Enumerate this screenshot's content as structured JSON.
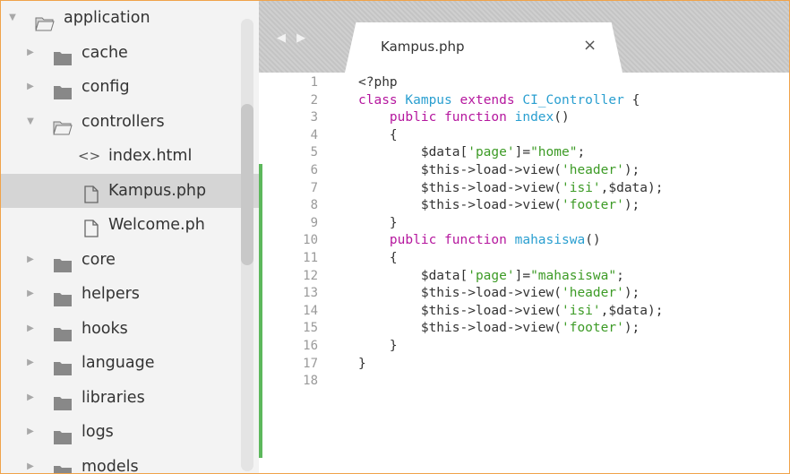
{
  "sidebar": {
    "items": [
      {
        "label": "application",
        "type": "folder-open",
        "depth": 0
      },
      {
        "label": "cache",
        "type": "folder",
        "depth": 1
      },
      {
        "label": "config",
        "type": "folder",
        "depth": 1
      },
      {
        "label": "controllers",
        "type": "folder-open",
        "depth": 1
      },
      {
        "label": "index.html",
        "type": "code-file",
        "depth": 2
      },
      {
        "label": "Kampus.php",
        "type": "file",
        "depth": 2,
        "selected": true
      },
      {
        "label": "Welcome.ph",
        "type": "file",
        "depth": 2
      },
      {
        "label": "core",
        "type": "folder",
        "depth": 1
      },
      {
        "label": "helpers",
        "type": "folder",
        "depth": 1
      },
      {
        "label": "hooks",
        "type": "folder",
        "depth": 1
      },
      {
        "label": "language",
        "type": "folder",
        "depth": 1
      },
      {
        "label": "libraries",
        "type": "folder",
        "depth": 1
      },
      {
        "label": "logs",
        "type": "folder",
        "depth": 1
      },
      {
        "label": "models",
        "type": "folder",
        "depth": 1
      }
    ]
  },
  "tabs": {
    "nav_arrows": "◀ ▶",
    "active": {
      "label": "Kampus.php",
      "close": "×"
    }
  },
  "code": {
    "lines": [
      {
        "n": "1",
        "tokens": [
          [
            "plain",
            "<?php"
          ]
        ]
      },
      {
        "n": "2",
        "tokens": [
          [
            "kw",
            "class "
          ],
          [
            "cls",
            "Kampus "
          ],
          [
            "kw",
            "extends "
          ],
          [
            "cls",
            "CI_Controller"
          ],
          [
            "plain",
            " {"
          ]
        ]
      },
      {
        "n": "3",
        "tokens": [
          [
            "plain",
            "    "
          ],
          [
            "kw",
            "public function "
          ],
          [
            "fn",
            "index"
          ],
          [
            "plain",
            "()"
          ]
        ]
      },
      {
        "n": "4",
        "tokens": [
          [
            "plain",
            "    {"
          ]
        ]
      },
      {
        "n": "5",
        "tokens": [
          [
            "plain",
            "        $data["
          ],
          [
            "str",
            "'page'"
          ],
          [
            "plain",
            "]="
          ],
          [
            "str",
            "\"home\""
          ],
          [
            "plain",
            ";"
          ]
        ]
      },
      {
        "n": "6",
        "tokens": [
          [
            "plain",
            "        $this->load->view("
          ],
          [
            "str",
            "'header'"
          ],
          [
            "plain",
            ");"
          ]
        ]
      },
      {
        "n": "7",
        "tokens": [
          [
            "plain",
            "        $this->load->view("
          ],
          [
            "str",
            "'isi'"
          ],
          [
            "plain",
            ",$data);"
          ]
        ]
      },
      {
        "n": "8",
        "tokens": [
          [
            "plain",
            "        $this->load->view("
          ],
          [
            "str",
            "'footer'"
          ],
          [
            "plain",
            ");"
          ]
        ]
      },
      {
        "n": "9",
        "tokens": [
          [
            "plain",
            "    }"
          ]
        ]
      },
      {
        "n": "10",
        "tokens": [
          [
            "plain",
            "    "
          ],
          [
            "kw",
            "public function "
          ],
          [
            "fn",
            "mahasiswa"
          ],
          [
            "plain",
            "()"
          ]
        ]
      },
      {
        "n": "11",
        "tokens": [
          [
            "plain",
            "    {"
          ]
        ]
      },
      {
        "n": "12",
        "tokens": [
          [
            "plain",
            "        $data["
          ],
          [
            "str",
            "'page'"
          ],
          [
            "plain",
            "]="
          ],
          [
            "str",
            "\"mahasiswa\""
          ],
          [
            "plain",
            ";"
          ]
        ]
      },
      {
        "n": "13",
        "tokens": [
          [
            "plain",
            "        $this->load->view("
          ],
          [
            "str",
            "'header'"
          ],
          [
            "plain",
            ");"
          ]
        ]
      },
      {
        "n": "14",
        "tokens": [
          [
            "plain",
            "        $this->load->view("
          ],
          [
            "str",
            "'isi'"
          ],
          [
            "plain",
            ",$data);"
          ]
        ]
      },
      {
        "n": "15",
        "tokens": [
          [
            "plain",
            "        $this->load->view("
          ],
          [
            "str",
            "'footer'"
          ],
          [
            "plain",
            ");"
          ]
        ]
      },
      {
        "n": "16",
        "tokens": [
          [
            "plain",
            "    }"
          ]
        ]
      },
      {
        "n": "17",
        "tokens": [
          [
            "plain",
            "}"
          ]
        ]
      },
      {
        "n": "18",
        "tokens": []
      }
    ]
  },
  "colors": {
    "keyword": "#b5179e",
    "class_name": "#2a9fd0",
    "string": "#3d9b26",
    "modified_marker": "#5db85c",
    "window_border": "#f0a34a"
  }
}
